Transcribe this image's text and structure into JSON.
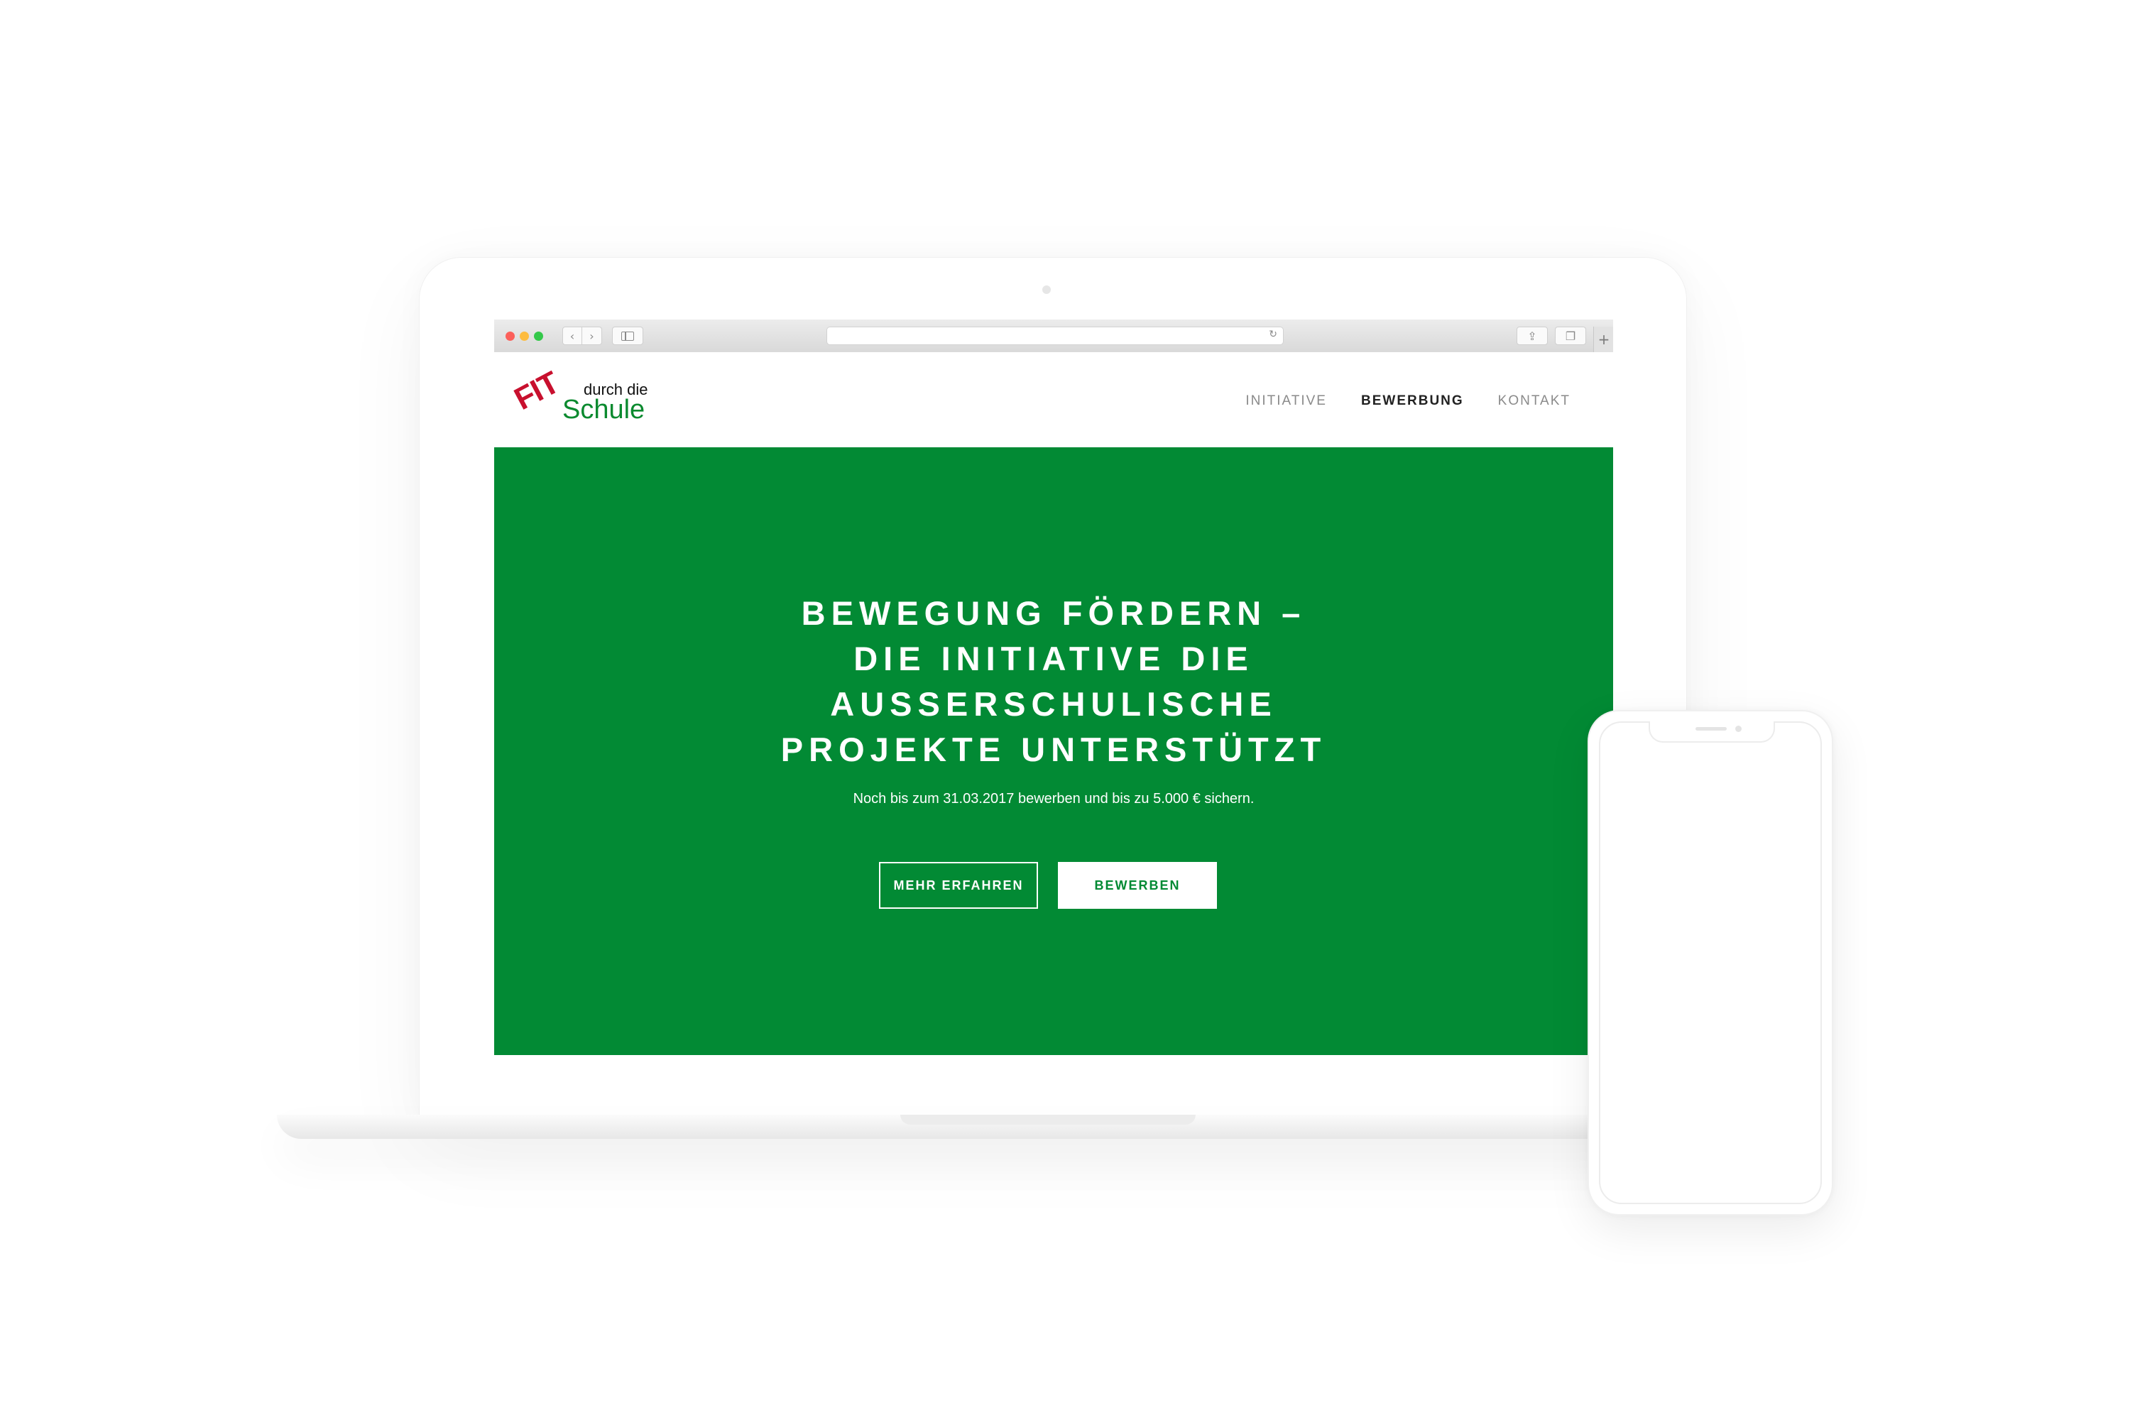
{
  "browser": {
    "address_value": "",
    "icons": {
      "back": "chevron-left-icon",
      "forward": "chevron-right-icon",
      "sidebar": "sidebar-icon",
      "reload": "reload-icon",
      "share": "share-icon",
      "tabs": "tabs-icon",
      "new_tab": "plus-icon"
    }
  },
  "site": {
    "logo": {
      "fit": "FIT",
      "durch_die": "durch die",
      "schule": "Schule"
    },
    "nav": {
      "items": [
        {
          "label": "INITIATIVE",
          "active": false
        },
        {
          "label": "BEWERBUNG",
          "active": true
        },
        {
          "label": "KONTAKT",
          "active": false
        }
      ]
    },
    "hero": {
      "title_lines": [
        "BEWEGUNG FÖRDERN –",
        "DIE INITIATIVE DIE",
        "AUSSERSCHULISCHE",
        "PROJEKTE UNTERSTÜTZT"
      ],
      "subtitle": "Noch bis zum 31.03.2017 bewerben und bis zu 5.000 € sichern.",
      "buttons": {
        "primary_outline": "MEHR ERFAHREN",
        "primary_solid": "BEWERBEN"
      }
    }
  },
  "colors": {
    "brand_green": "#028a34",
    "logo_red": "#c8102e",
    "logo_green": "#0b8a2f",
    "nav_active": "#222222",
    "nav_inactive": "#8a8a8a"
  }
}
